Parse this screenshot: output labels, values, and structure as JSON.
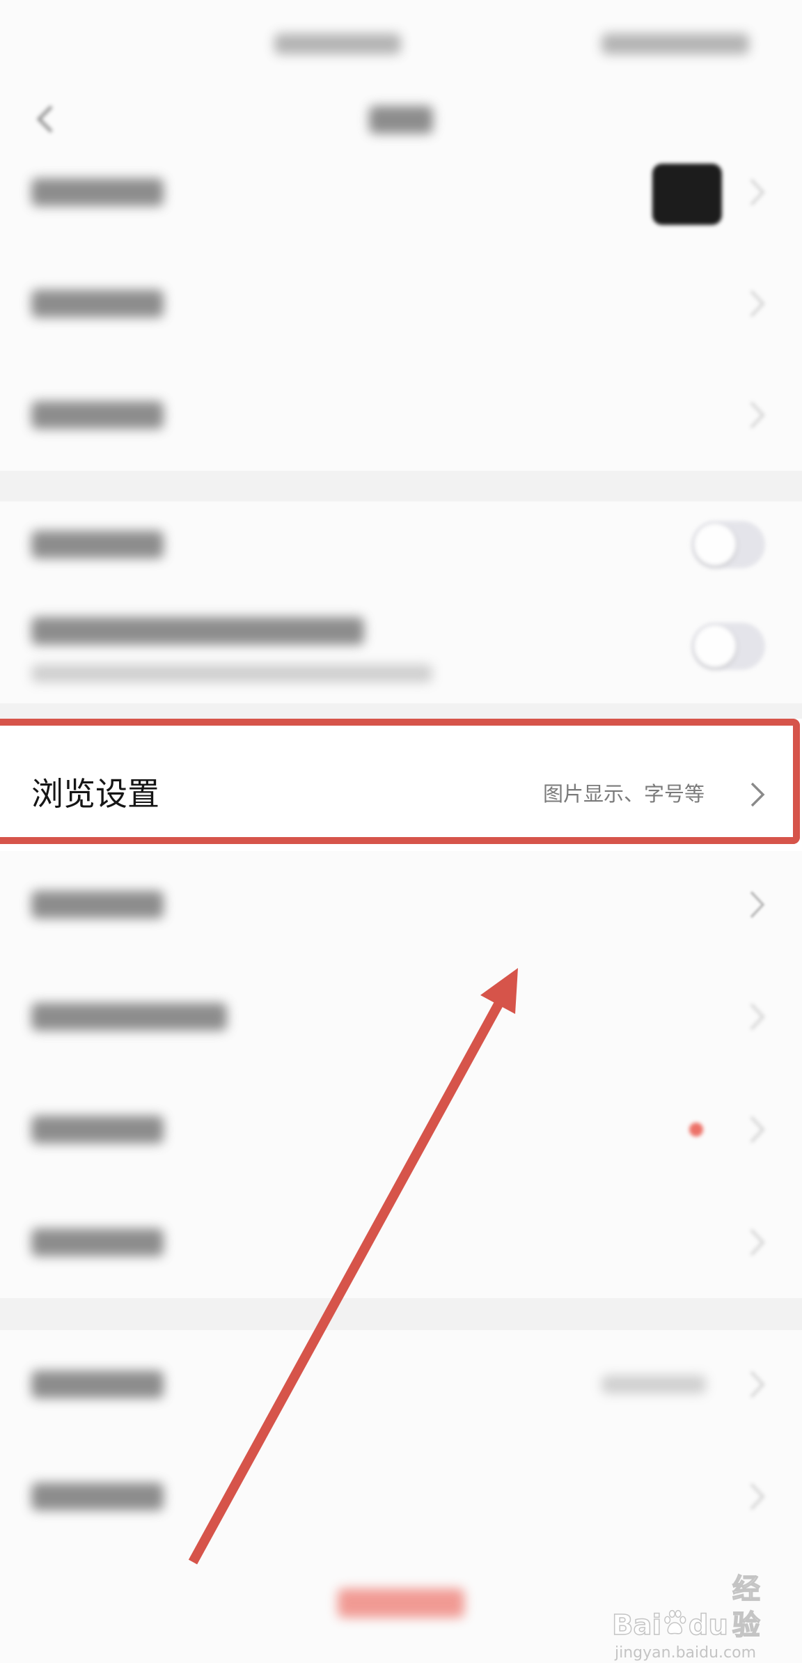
{
  "colors": {
    "annotation": "#d6544a",
    "page_background": "#fbfbfb",
    "section_gap": "#f2f2f2",
    "row_background": "#ffffff",
    "label_text": "#151515",
    "hint_text": "#7a7a7a",
    "chevron": "#8a8a8a",
    "badge_dot": "#ea5a4f",
    "watermark": "#c4c4c4"
  },
  "icons": {
    "back": "back-arrow-icon",
    "row_arrow": "chevron-right-icon",
    "badge": "red-dot-badge",
    "watermark_logo": "baidu-paw-icon"
  },
  "highlighted_row": {
    "label": "浏览设置",
    "hint": "图片显示、字号等"
  },
  "toggles": [
    {
      "on": false
    },
    {
      "on": false
    }
  ],
  "watermark": {
    "brand_left": "Bai",
    "brand_right": "du",
    "product": "经验",
    "site": "jingyan.baidu.com"
  }
}
